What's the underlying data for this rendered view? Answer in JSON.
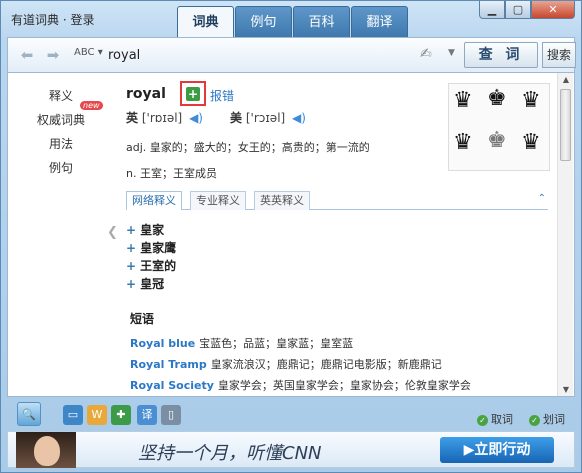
{
  "app": {
    "title": "有道词典 · 登录"
  },
  "tabs": [
    {
      "label": "词典",
      "active": true
    },
    {
      "label": "例句",
      "active": false
    },
    {
      "label": "百科",
      "active": false
    },
    {
      "label": "翻译",
      "active": false
    }
  ],
  "search": {
    "abc": "ABC",
    "query": "royal",
    "button": "查 词",
    "search_label": "搜索"
  },
  "leftnav": {
    "items": [
      "释义",
      "权威词典",
      "用法",
      "例句"
    ],
    "new_badge": "new"
  },
  "entry": {
    "word": "royal",
    "report": "报错",
    "uk_label": "英",
    "uk_ipa": "['rɒɪəl]",
    "us_label": "美",
    "us_ipa": "['rɔɪəl]",
    "defs": [
      "adj. 皇家的；盛大的；女王的；高贵的；第一流的",
      "n. 王室；王室成员"
    ]
  },
  "subtabs": [
    "网络释义",
    "专业释义",
    "英英释义"
  ],
  "web_defs": [
    "皇家",
    "皇家鹰",
    "王室的",
    "皇冠"
  ],
  "phrases_title": "短语",
  "phrases": [
    {
      "en": "Royal blue",
      "cn": "宝蓝色；品蓝；皇家蓝；皇室蓝"
    },
    {
      "en": "Royal Tramp",
      "cn": "皇家流浪汉；鹿鼎记；鹿鼎记电影版；新鹿鼎记"
    },
    {
      "en": "Royal Society",
      "cn": "皇家学会；英国皇家学会；皇家协会；伦敦皇家学会"
    }
  ],
  "toolbar": {
    "quci": "取词",
    "huaci": "划词"
  },
  "banner": {
    "slogan": "坚持一个月，听懂CNN",
    "cta": "▶立即行动"
  }
}
